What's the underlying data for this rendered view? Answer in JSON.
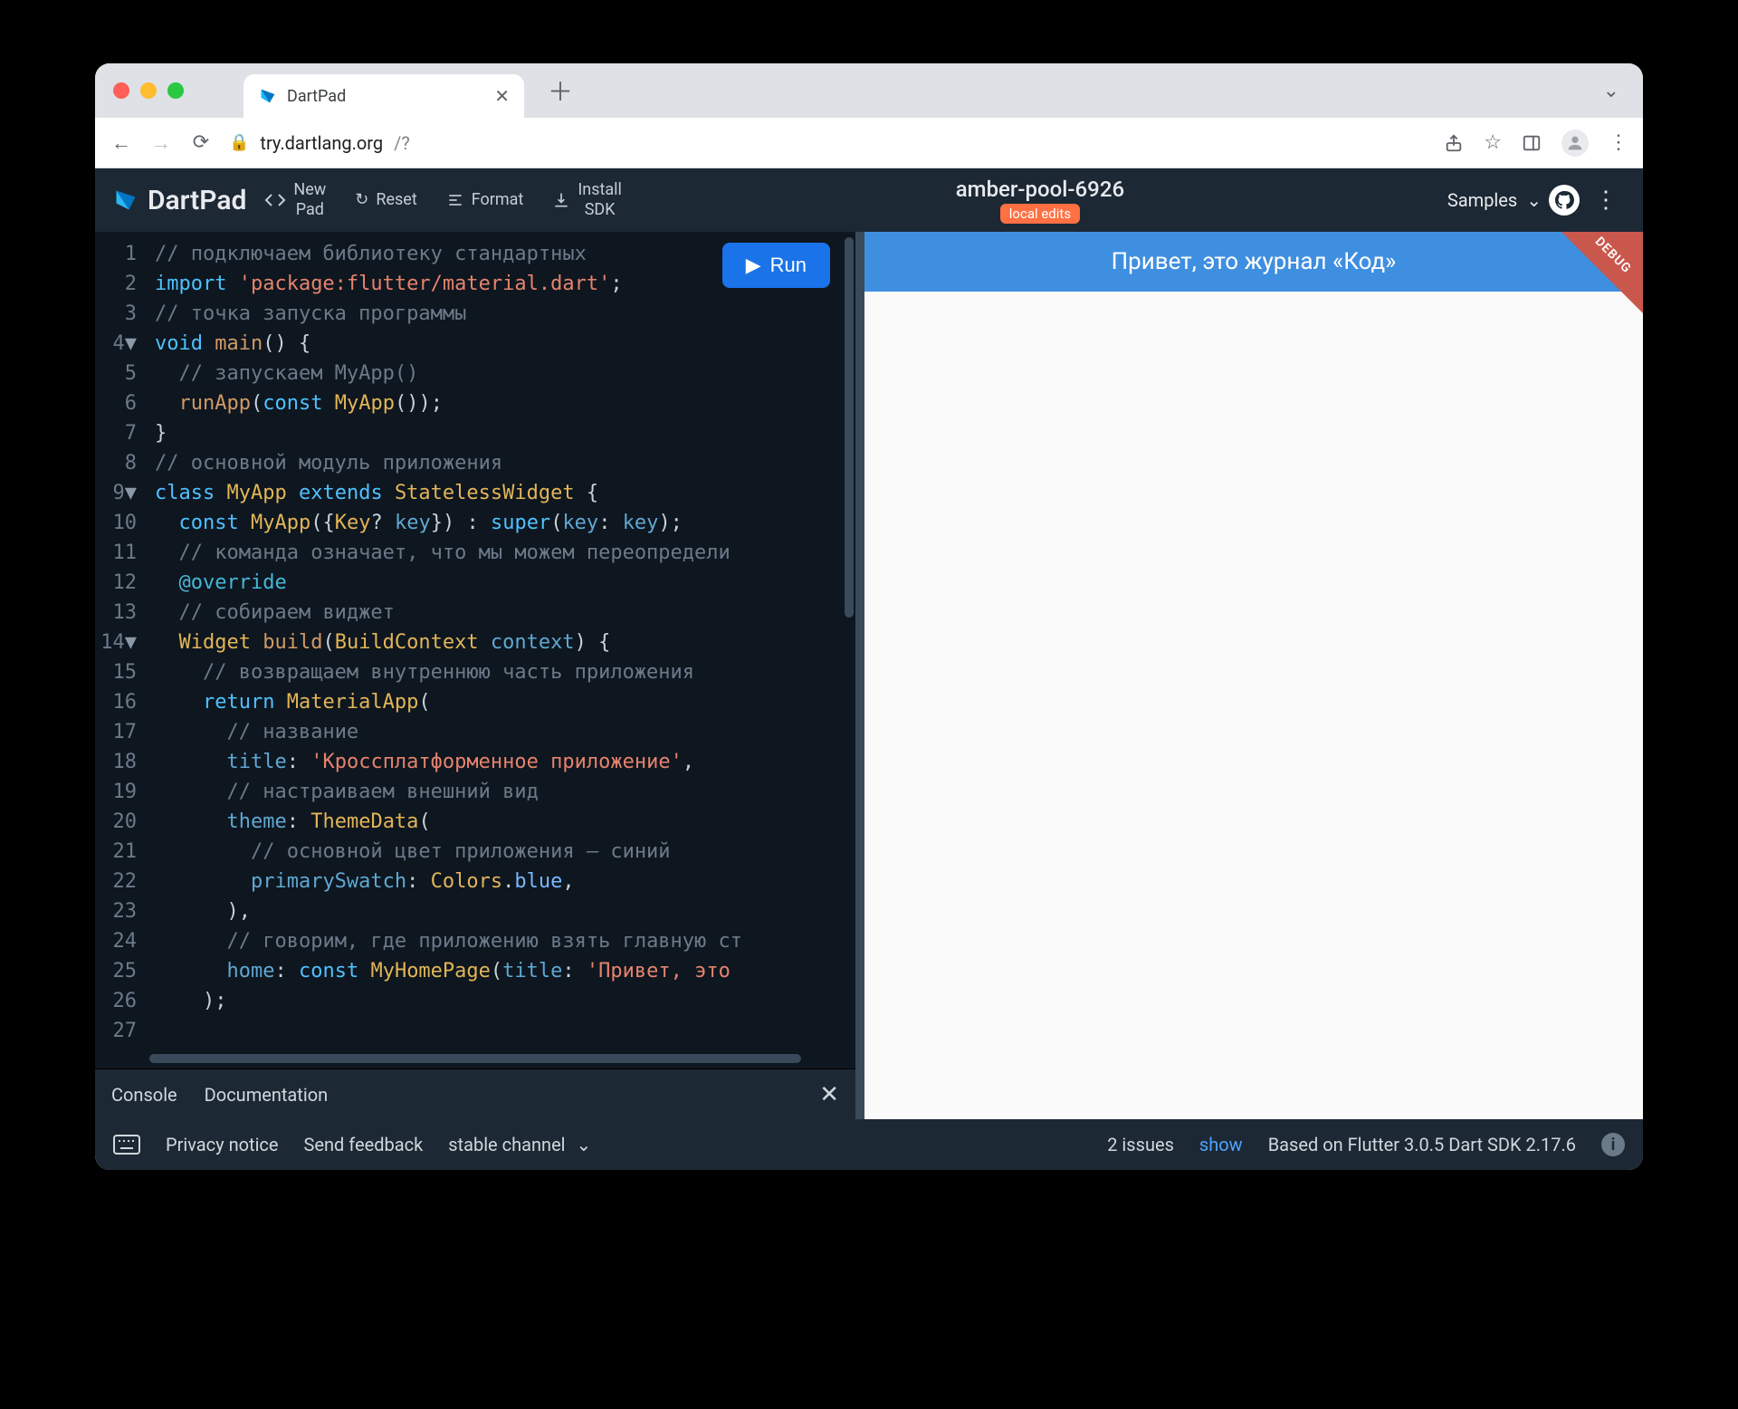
{
  "browser": {
    "tab_title": "DartPad",
    "url_host": "try.dartlang.org",
    "url_path": "/?"
  },
  "toolbar": {
    "logo": "DartPad",
    "new_pad": "New\nPad",
    "reset": "Reset",
    "format": "Format",
    "install_sdk": "Install\nSDK",
    "samples": "Samples"
  },
  "project": {
    "name": "amber-pool-6926",
    "badge": "local edits"
  },
  "run_label": "Run",
  "editor": {
    "lines": [
      {
        "n": "1",
        "fold": "",
        "tokens": [
          {
            "c": "c-comment",
            "t": "// подключаем библиотеку стандартных "
          }
        ]
      },
      {
        "n": "2",
        "fold": "",
        "tokens": [
          {
            "c": "c-key",
            "t": "import "
          },
          {
            "c": "c-str",
            "t": "'package:flutter/material.dart'"
          },
          {
            "c": "",
            "t": ";"
          }
        ]
      },
      {
        "n": "3",
        "fold": "",
        "tokens": [
          {
            "c": "c-comment",
            "t": "// точка запуска программы"
          }
        ]
      },
      {
        "n": "4",
        "fold": "▼",
        "tokens": [
          {
            "c": "c-key",
            "t": "void "
          },
          {
            "c": "c-func",
            "t": "main"
          },
          {
            "c": "",
            "t": "() {"
          }
        ]
      },
      {
        "n": "5",
        "fold": "",
        "tokens": [
          {
            "c": "",
            "t": "  "
          },
          {
            "c": "c-comment",
            "t": "// запускаем MyApp()"
          }
        ]
      },
      {
        "n": "6",
        "fold": "",
        "tokens": [
          {
            "c": "",
            "t": "  "
          },
          {
            "c": "c-func",
            "t": "runApp"
          },
          {
            "c": "",
            "t": "("
          },
          {
            "c": "c-key",
            "t": "const "
          },
          {
            "c": "c-type",
            "t": "MyApp"
          },
          {
            "c": "",
            "t": "());"
          }
        ]
      },
      {
        "n": "7",
        "fold": "",
        "tokens": [
          {
            "c": "",
            "t": "}"
          }
        ]
      },
      {
        "n": "8",
        "fold": "",
        "tokens": [
          {
            "c": "c-comment",
            "t": "// основной модуль приложения"
          }
        ]
      },
      {
        "n": "9",
        "fold": "▼",
        "tokens": [
          {
            "c": "c-key",
            "t": "class "
          },
          {
            "c": "c-type",
            "t": "MyApp "
          },
          {
            "c": "c-key",
            "t": "extends "
          },
          {
            "c": "c-type",
            "t": "StatelessWidget "
          },
          {
            "c": "",
            "t": "{"
          }
        ]
      },
      {
        "n": "10",
        "fold": "",
        "tokens": [
          {
            "c": "",
            "t": "  "
          },
          {
            "c": "c-key",
            "t": "const "
          },
          {
            "c": "c-type",
            "t": "MyApp"
          },
          {
            "c": "",
            "t": "({"
          },
          {
            "c": "c-type",
            "t": "Key"
          },
          {
            "c": "",
            "t": "? "
          },
          {
            "c": "c-ident",
            "t": "key"
          },
          {
            "c": "",
            "t": "}) : "
          },
          {
            "c": "c-key",
            "t": "super"
          },
          {
            "c": "",
            "t": "("
          },
          {
            "c": "c-ident",
            "t": "key"
          },
          {
            "c": "",
            "t": ": "
          },
          {
            "c": "c-ident",
            "t": "key"
          },
          {
            "c": "",
            "t": ");"
          }
        ]
      },
      {
        "n": "11",
        "fold": "",
        "tokens": [
          {
            "c": "",
            "t": "  "
          },
          {
            "c": "c-comment",
            "t": "// команда означает, что мы можем переопредели"
          }
        ]
      },
      {
        "n": "12",
        "fold": "",
        "tokens": [
          {
            "c": "",
            "t": "  "
          },
          {
            "c": "c-key2",
            "t": "@override"
          }
        ]
      },
      {
        "n": "13",
        "fold": "",
        "tokens": [
          {
            "c": "",
            "t": "  "
          },
          {
            "c": "c-comment",
            "t": "// собираем виджет"
          }
        ]
      },
      {
        "n": "14",
        "fold": "▼",
        "tokens": [
          {
            "c": "",
            "t": "  "
          },
          {
            "c": "c-type",
            "t": "Widget "
          },
          {
            "c": "c-func",
            "t": "build"
          },
          {
            "c": "",
            "t": "("
          },
          {
            "c": "c-type",
            "t": "BuildContext "
          },
          {
            "c": "c-ident",
            "t": "context"
          },
          {
            "c": "",
            "t": ") {"
          }
        ]
      },
      {
        "n": "15",
        "fold": "",
        "tokens": [
          {
            "c": "",
            "t": "    "
          },
          {
            "c": "c-comment",
            "t": "// возвращаем внутреннюю часть приложения"
          }
        ]
      },
      {
        "n": "16",
        "fold": "",
        "tokens": [
          {
            "c": "",
            "t": "    "
          },
          {
            "c": "c-key",
            "t": "return "
          },
          {
            "c": "c-type",
            "t": "MaterialApp"
          },
          {
            "c": "",
            "t": "("
          }
        ]
      },
      {
        "n": "17",
        "fold": "",
        "tokens": [
          {
            "c": "",
            "t": "      "
          },
          {
            "c": "c-comment",
            "t": "// название"
          }
        ]
      },
      {
        "n": "18",
        "fold": "",
        "tokens": [
          {
            "c": "",
            "t": "      "
          },
          {
            "c": "c-ident",
            "t": "title"
          },
          {
            "c": "",
            "t": ": "
          },
          {
            "c": "c-str",
            "t": "'Кроссплатформенное приложение'"
          },
          {
            "c": "",
            "t": ","
          }
        ]
      },
      {
        "n": "19",
        "fold": "",
        "tokens": [
          {
            "c": "",
            "t": "      "
          },
          {
            "c": "c-comment",
            "t": "// настраиваем внешний вид"
          }
        ]
      },
      {
        "n": "20",
        "fold": "",
        "tokens": [
          {
            "c": "",
            "t": "      "
          },
          {
            "c": "c-ident",
            "t": "theme"
          },
          {
            "c": "",
            "t": ": "
          },
          {
            "c": "c-type",
            "t": "ThemeData"
          },
          {
            "c": "",
            "t": "("
          }
        ]
      },
      {
        "n": "21",
        "fold": "",
        "tokens": [
          {
            "c": "",
            "t": "        "
          },
          {
            "c": "c-comment",
            "t": "// основной цвет приложения — синий"
          }
        ]
      },
      {
        "n": "22",
        "fold": "",
        "tokens": [
          {
            "c": "",
            "t": "        "
          },
          {
            "c": "c-ident",
            "t": "primarySwatch"
          },
          {
            "c": "",
            "t": ": "
          },
          {
            "c": "c-type",
            "t": "Colors"
          },
          {
            "c": "",
            "t": "."
          },
          {
            "c": "c-prop",
            "t": "blue"
          },
          {
            "c": "",
            "t": ","
          }
        ]
      },
      {
        "n": "23",
        "fold": "",
        "tokens": [
          {
            "c": "",
            "t": "      ),"
          }
        ]
      },
      {
        "n": "24",
        "fold": "",
        "tokens": [
          {
            "c": "",
            "t": "      "
          },
          {
            "c": "c-comment",
            "t": "// говорим, где приложению взять главную ст"
          }
        ]
      },
      {
        "n": "25",
        "fold": "",
        "tokens": [
          {
            "c": "",
            "t": "      "
          },
          {
            "c": "c-ident",
            "t": "home"
          },
          {
            "c": "",
            "t": ": "
          },
          {
            "c": "c-key",
            "t": "const "
          },
          {
            "c": "c-type",
            "t": "MyHomePage"
          },
          {
            "c": "",
            "t": "("
          },
          {
            "c": "c-ident",
            "t": "title"
          },
          {
            "c": "",
            "t": ": "
          },
          {
            "c": "c-str",
            "t": "'Привет, это "
          }
        ]
      },
      {
        "n": "26",
        "fold": "",
        "tokens": [
          {
            "c": "",
            "t": "    );"
          }
        ]
      },
      {
        "n": "27",
        "fold": "",
        "tokens": [
          {
            "c": "",
            "t": ""
          }
        ]
      }
    ]
  },
  "console": {
    "tab1": "Console",
    "tab2": "Documentation"
  },
  "preview": {
    "appbar_title": "Привет, это журнал «Код»",
    "debug": "DEBUG"
  },
  "footer": {
    "privacy": "Privacy notice",
    "feedback": "Send feedback",
    "channel": "stable channel",
    "issues": "2 issues",
    "show": "show",
    "based": "Based on Flutter 3.0.5 Dart SDK 2.17.6"
  }
}
